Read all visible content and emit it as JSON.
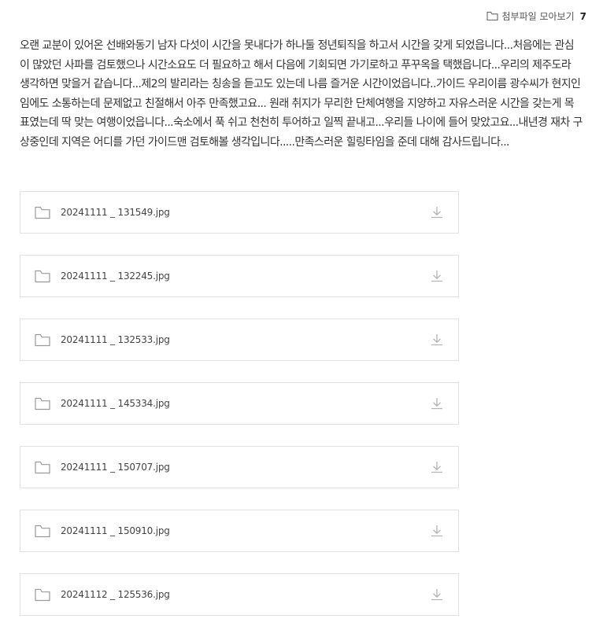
{
  "attachments_header": {
    "label": "첨부파일 모아보기",
    "count": "7",
    "icon": "folder-icon"
  },
  "review": {
    "text": "오랜 교분이 있어온 선배와동기 남자 다섯이 시간을 못내다가 하나둘 정년퇴직을 하고서 시간을 갖게  되었읍니다...처음에는 관심이 많았던 사파를 검토했으나 시간소요도 더 필요하고 해서 다음에 기회되면 가기로하고 푸꾸옥을 택했읍니다...우리의 제주도라  생각하면 맞을거 같습니다...제2의 발리라는 칭송을 듣고도 있는데 나름 즐거운 시간이었읍니다..가이드 우리이름 광수씨가 현지인임에도 소통하는데 문제없고 친절해서 아주  만족했고요... 원래 취지가 무리한 단체여행을 지양하고 자유스러운 시간을  갖는게 목표였는데  딱  맞는 여행이었읍니다...숙소에서 푹 쉬고 천천히 투어하고 일찍 끝내고...우리들 나이에 들어 맞았고요...내년경 재차 구상중인데 지역은 어디를 가던 가이드맨 검토해볼 생각입니다.....만족스러운 힐링타임을 준데 대해 감사드립니다..."
  },
  "files": [
    {
      "name": "20241111 _ 131549.jpg"
    },
    {
      "name": "20241111 _ 132245.jpg"
    },
    {
      "name": "20241111 _ 132533.jpg"
    },
    {
      "name": "20241111 _ 145334.jpg"
    },
    {
      "name": "20241111 _ 150707.jpg"
    },
    {
      "name": "20241111 _ 150910.jpg"
    },
    {
      "name": "20241112 _ 125536.jpg"
    }
  ],
  "icons": {
    "file_icon": "folder-icon",
    "action_icon": "download-icon"
  },
  "colors": {
    "text": "#333333",
    "border": "#e2e2e2",
    "icon": "#9a9a9a"
  }
}
